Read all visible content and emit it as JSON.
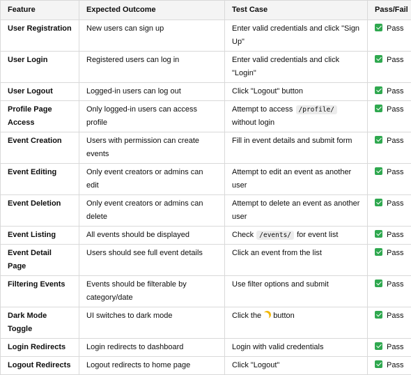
{
  "headers": [
    "Feature",
    "Expected Outcome",
    "Test Case",
    "Pass/Fail"
  ],
  "rows": [
    {
      "feature": "User Registration",
      "outcome": "New users can sign up",
      "test": "Enter valid credentials and click \"Sign Up\"",
      "result": "Pass"
    },
    {
      "feature": "User Login",
      "outcome": "Registered users can log in",
      "test": "Enter valid credentials and click \"Login\"",
      "result": "Pass"
    },
    {
      "feature": "User Logout",
      "outcome": "Logged-in users can log out",
      "test": "Click \"Logout\" button",
      "result": "Pass"
    },
    {
      "feature": "Profile Page Access",
      "outcome": "Only logged-in users can access profile",
      "test_pre": "Attempt to access",
      "test_code": "/profile/",
      "test_post": "without login",
      "result": "Pass"
    },
    {
      "feature": "Event Creation",
      "outcome": "Users with permission can create events",
      "test": "Fill in event details and submit form",
      "result": "Pass"
    },
    {
      "feature": "Event Editing",
      "outcome": "Only event creators or admins can edit",
      "test": "Attempt to edit an event as another user",
      "result": "Pass"
    },
    {
      "feature": "Event Deletion",
      "outcome": "Only event creators or admins can delete",
      "test": "Attempt to delete an event as another user",
      "result": "Pass"
    },
    {
      "feature": "Event Listing",
      "outcome": "All events should be displayed",
      "test_pre": "Check",
      "test_code": "/events/",
      "test_post": "for event list",
      "result": "Pass"
    },
    {
      "feature": "Event Detail Page",
      "outcome": "Users should see full event details",
      "test": "Click an event from the list",
      "result": "Pass"
    },
    {
      "feature": "Filtering Events",
      "outcome": "Events should be filterable by category/date",
      "test": "Use filter options and submit",
      "result": "Pass"
    },
    {
      "feature": "Dark Mode Toggle",
      "outcome": "UI switches to dark mode",
      "test_pre": "Click the",
      "test_icon": "moon-icon",
      "test_post": "button",
      "result": "Pass"
    },
    {
      "feature": "Login Redirects",
      "outcome": "Login redirects to dashboard",
      "test": "Login with valid credentials",
      "result": "Pass"
    },
    {
      "feature": "Logout Redirects",
      "outcome": "Logout redirects to home page",
      "test": "Click \"Logout\"",
      "result": "Pass"
    }
  ],
  "colors": {
    "pass_check": "#2fa84f",
    "header_bg": "#f4f4f4",
    "border": "#d9d9d9",
    "moon": "#f2b705"
  }
}
